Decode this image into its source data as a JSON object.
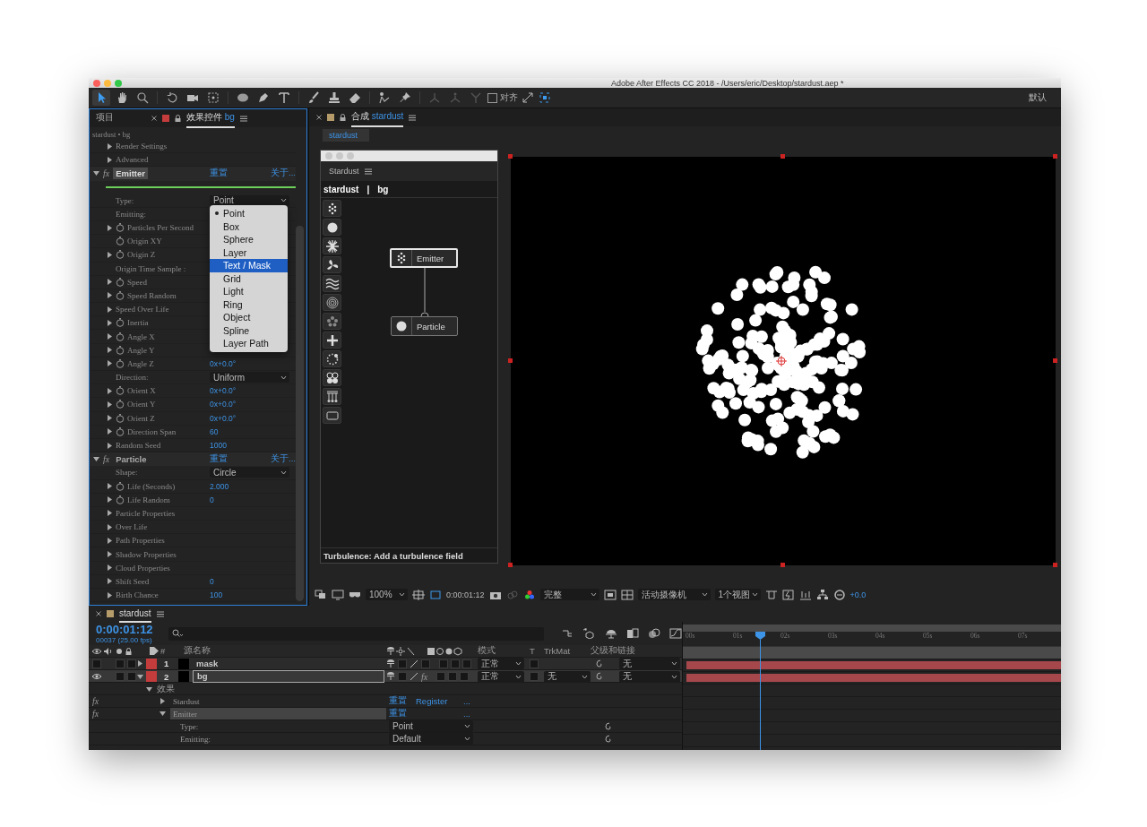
{
  "window": {
    "title": "Adobe After Effects CC 2018 - /Users/eric/Desktop/stardust.aep *"
  },
  "toolbar": {
    "snap": {
      "label": "对齐",
      "checked": false
    },
    "workspace": "默认"
  },
  "effect_panel": {
    "tabs": [
      {
        "label": "项目",
        "selected": false
      },
      {
        "label": "效果控件",
        "layer": "bg",
        "selected": true
      }
    ],
    "breadcrumb": "stardust • bg",
    "leading_rows": [
      {
        "kind": "property",
        "label": "Render Settings",
        "expanded": false,
        "stopwatch": false
      },
      {
        "kind": "property",
        "label": "Advanced",
        "expanded": false,
        "stopwatch": false
      }
    ],
    "effects": [
      {
        "fx": "fx",
        "name": "Emitter",
        "selected": true,
        "expanded": true,
        "reset": "重置",
        "about": "关于...",
        "rows": [
          {
            "kind": "dropdown",
            "label": "Type:",
            "value": "Point"
          },
          {
            "kind": "property",
            "label": "Emitting:",
            "stopwatch": false
          },
          {
            "kind": "property",
            "label": "Particles Per Second",
            "expanded": false,
            "stopwatch": true
          },
          {
            "kind": "property",
            "label": "Origin XY",
            "stopwatch": true
          },
          {
            "kind": "property",
            "label": "Origin Z",
            "expanded": false,
            "stopwatch": true
          },
          {
            "kind": "property",
            "label": "Origin Time Sample :",
            "stopwatch": false
          },
          {
            "kind": "property",
            "label": "Speed",
            "expanded": false,
            "stopwatch": true
          },
          {
            "kind": "property",
            "label": "Speed Random",
            "expanded": false,
            "stopwatch": true
          },
          {
            "kind": "property",
            "label": "Speed Over Life",
            "expanded": false,
            "stopwatch": false
          },
          {
            "kind": "property",
            "label": "Inertia",
            "expanded": false,
            "stopwatch": true
          },
          {
            "kind": "property",
            "label": "Angle X",
            "expanded": false,
            "stopwatch": true
          },
          {
            "kind": "property",
            "label": "Angle Y",
            "expanded": false,
            "stopwatch": true
          },
          {
            "kind": "property",
            "label": "Angle Z",
            "expanded": false,
            "stopwatch": true,
            "value": "0x+0.0°"
          },
          {
            "kind": "dropdown",
            "label": "Direction:",
            "value": "Uniform"
          },
          {
            "kind": "property",
            "label": "Orient X",
            "expanded": false,
            "stopwatch": true,
            "value": "0x+0.0°"
          },
          {
            "kind": "property",
            "label": "Orient Y",
            "expanded": false,
            "stopwatch": true,
            "value": "0x+0.0°"
          },
          {
            "kind": "property",
            "label": "Orient Z",
            "expanded": false,
            "stopwatch": true,
            "value": "0x+0.0°"
          },
          {
            "kind": "property",
            "label": "Direction Span",
            "expanded": false,
            "stopwatch": true,
            "value": "60"
          },
          {
            "kind": "property",
            "label": "Random Seed",
            "expanded": false,
            "stopwatch": false,
            "value": "1000"
          }
        ]
      },
      {
        "fx": "fx",
        "name": "Particle",
        "selected": false,
        "expanded": true,
        "reset": "重置",
        "about": "关于...",
        "rows": [
          {
            "kind": "dropdown",
            "label": "Shape:",
            "value": "Circle"
          },
          {
            "kind": "property",
            "label": "Life (Seconds)",
            "expanded": false,
            "stopwatch": true,
            "value": "2.000"
          },
          {
            "kind": "property",
            "label": "Life Random",
            "expanded": false,
            "stopwatch": true,
            "value": "0"
          },
          {
            "kind": "property",
            "label": "Particle Properties",
            "expanded": false,
            "stopwatch": false
          },
          {
            "kind": "property",
            "label": "Over Life",
            "expanded": false,
            "stopwatch": false
          },
          {
            "kind": "property",
            "label": "Path Properties",
            "expanded": false,
            "stopwatch": false
          },
          {
            "kind": "property",
            "label": "Shadow Properties",
            "expanded": false,
            "stopwatch": false
          },
          {
            "kind": "property",
            "label": "Cloud Properties",
            "expanded": false,
            "stopwatch": false
          },
          {
            "kind": "property",
            "label": "Shift Seed",
            "expanded": false,
            "stopwatch": false,
            "value": "0"
          },
          {
            "kind": "property",
            "label": "Birth Chance",
            "expanded": false,
            "stopwatch": false,
            "value": "100"
          }
        ]
      }
    ]
  },
  "type_menu": {
    "items": [
      {
        "label": "Point",
        "checked": true,
        "selected": false
      },
      {
        "label": "Box",
        "checked": false,
        "selected": false
      },
      {
        "label": "Sphere",
        "checked": false,
        "selected": false
      },
      {
        "label": "Layer",
        "checked": false,
        "selected": false
      },
      {
        "label": "Text / Mask",
        "checked": false,
        "selected": true
      },
      {
        "label": "Grid",
        "checked": false,
        "selected": false
      },
      {
        "label": "Light",
        "checked": false,
        "selected": false
      },
      {
        "label": "Ring",
        "checked": false,
        "selected": false
      },
      {
        "label": "Object",
        "checked": false,
        "selected": false
      },
      {
        "label": "Spline",
        "checked": false,
        "selected": false
      },
      {
        "label": "Layer Path",
        "checked": false,
        "selected": false
      }
    ]
  },
  "composition_panel": {
    "tab_prefix": "合成",
    "tab_name": "stardust",
    "subtab": "stardust",
    "viewer_bar": {
      "zoom": "100%",
      "timecode": "0:00:01:12",
      "resolution": "完整",
      "camera": "活动摄像机",
      "views": "1个视图",
      "exposure": "+0.0"
    }
  },
  "stardust_window": {
    "title": "Stardust",
    "comp": "stardust",
    "separator": "|",
    "layer": "bg",
    "nodes": [
      {
        "kind": "emitter",
        "label": "Emitter",
        "selected": true
      },
      {
        "kind": "particle",
        "label": "Particle",
        "selected": false
      }
    ],
    "status": "Turbulence: Add a turbulence field"
  },
  "timeline": {
    "tab": "stardust",
    "timecode": "0:00:01:12",
    "frame_info": "00037 (25.00 fps)",
    "columns": {
      "number": "#",
      "source": "源名称",
      "mode": "模式",
      "t": "T",
      "trkmat": "TrkMat",
      "parent": "父级和链接"
    },
    "ruler": [
      "00s",
      "01s",
      "02s",
      "03s",
      "04s",
      "05s",
      "06s",
      "07s"
    ],
    "layers": [
      {
        "number": "1",
        "name": "mask",
        "visible": false,
        "expanded": false,
        "selected": false,
        "mode": "正常",
        "parent": "无"
      },
      {
        "number": "2",
        "name": "bg",
        "visible": true,
        "expanded": true,
        "selected": true,
        "fx_switch": "fx",
        "mode": "正常",
        "trkmat": "无",
        "parent": "无",
        "children": [
          {
            "kind": "group",
            "label": "效果",
            "expanded": true,
            "children": [
              {
                "kind": "effect",
                "fx": "fx",
                "label": "Stardust",
                "expanded": false,
                "selected": false,
                "reset": "重置",
                "register": "Register",
                "about": "..."
              },
              {
                "kind": "effect",
                "fx": "fx",
                "label": "Emitter",
                "expanded": true,
                "selected": true,
                "reset": "重置",
                "about": "...",
                "children": [
                  {
                    "kind": "property",
                    "label": "Type:",
                    "value": "Point"
                  },
                  {
                    "kind": "property",
                    "label": "Emitting:",
                    "value": "Default"
                  }
                ]
              }
            ]
          }
        ]
      }
    ]
  }
}
